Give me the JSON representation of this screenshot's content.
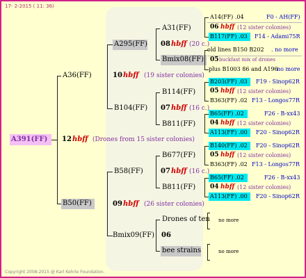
{
  "header": "17- 2-2015 ( 11: 36)",
  "footer": "Copyright 2008-2015 @ Karl Kehrle Foundation.",
  "colors": {
    "border": "#d0208a",
    "background": "#ffffd0",
    "highlight_cyan": "#00e8f0",
    "italic_red": "#d00000",
    "purple": "#8030a0"
  },
  "root": {
    "name": "A391(FF)",
    "year": "12",
    "hbff": "hbff",
    "note": "(Drones from 15 sister colonies)"
  },
  "gen1": {
    "a36": {
      "name": "A36(FF)",
      "year": "10",
      "hbff": "hbff",
      "note": "(19 sister colonies)"
    },
    "b50": {
      "name": "B50(FF)",
      "year": "09",
      "hbff": "hbff",
      "note": "(26 sister colonies)"
    }
  },
  "gen2": {
    "a295": {
      "name": "A295(FF)",
      "year": "08",
      "hbff": "hbff",
      "note": "(20 c.)"
    },
    "b104": {
      "name": "B104(FF)",
      "year": "07",
      "hbff": "hbff",
      "note": "(16 c.)"
    },
    "b58": {
      "name": "B58(FF)",
      "year": "07",
      "hbff": "hbff",
      "note": "(16 c.)"
    },
    "bmix09": {
      "name": "Bmix09(FF)",
      "year": "06"
    }
  },
  "gen3": {
    "a31": {
      "name": "A31(FF)",
      "year": "06",
      "hbff": "hbff",
      "note": "(12 sister colonies)"
    },
    "bmix08": {
      "name": "Bmix08(FF)",
      "year": "05",
      "note": "buckfast mix of drones"
    },
    "b114": {
      "name": "B114(FF)",
      "year": "05",
      "hbff": "hbff",
      "note": "(12 sister colonies)"
    },
    "b811a": {
      "name": "B811(FF)",
      "year": "04",
      "hbff": "hbff",
      "note": "(12 sister colonies)"
    },
    "b677": {
      "name": "B677(FF)",
      "year": "05",
      "hbff": "hbff",
      "note": "(12 sister colonies)"
    },
    "b811b": {
      "name": "B811(FF)",
      "year": "04",
      "hbff": "hbff",
      "note": "(12 sister colonies)"
    },
    "drones": {
      "name": "Drones of ten",
      "more": "no more"
    },
    "beestrains": {
      "name": "bee strains",
      "more": "no more"
    }
  },
  "gen4": [
    {
      "left": "A14(FF) .04",
      "right": "F0 - AH(FF)"
    },
    {
      "left": "B117(FF) .03",
      "right": "F14 - Adami75R"
    },
    {
      "left": "old lines B150 B202",
      "right": ". no more"
    },
    {
      "left": "plus B1003 86 and A196",
      "right": "no more"
    },
    {
      "left": "B203(FF) .03",
      "right": "F19 - Sinop62R"
    },
    {
      "left": "B363(FF) .02",
      "right": "F13 - Longos77R"
    },
    {
      "left": "B65(FF) .02",
      "right": "F26 - B-xx43"
    },
    {
      "left": "A113(FF) .00",
      "right": "F20 - Sinop62R"
    },
    {
      "left": "B140(FF) .02",
      "right": "F20 - Sinop62R"
    },
    {
      "left": "B363(FF) .02",
      "right": "F13 - Longos77R"
    },
    {
      "left": "B65(FF) .02",
      "right": "F26 - B-xx43"
    },
    {
      "left": "A113(FF) .00",
      "right": "F20 - Sinop62R"
    }
  ]
}
